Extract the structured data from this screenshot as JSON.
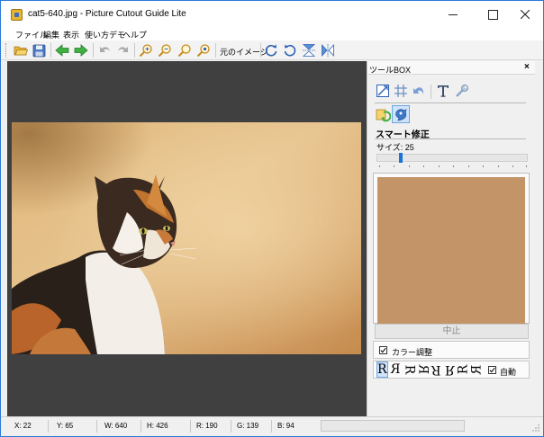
{
  "window": {
    "title": "cat5-640.jpg - Picture Cutout Guide Lite"
  },
  "menu": {
    "items": [
      "ファイル",
      "編集",
      "表示",
      "使い方デモ",
      "ヘルプ"
    ]
  },
  "toolbar": {
    "original_image_label": "元のイメージ"
  },
  "toolbox": {
    "title": "ツールBOX",
    "close_glyph": "×",
    "mode_title": "スマート修正",
    "size_label": "サイズ: 25",
    "size_value": 25,
    "stop_button": "中止",
    "color_adjust_label": "カラー調整",
    "color_adjust_checked": true,
    "rotation_glyph": "R",
    "auto_label": "自動",
    "auto_checked": true,
    "preview_color": "#c29467"
  },
  "status": {
    "x": "X: 22",
    "y": "Y: 65",
    "w": "W: 640",
    "h": "H: 426",
    "r": "R: 190",
    "g": "G: 139",
    "b": "B: 94"
  },
  "colors": {
    "accent": "#1e72d6",
    "canvas_background": "#404040",
    "window_border": "#2b79d6"
  }
}
